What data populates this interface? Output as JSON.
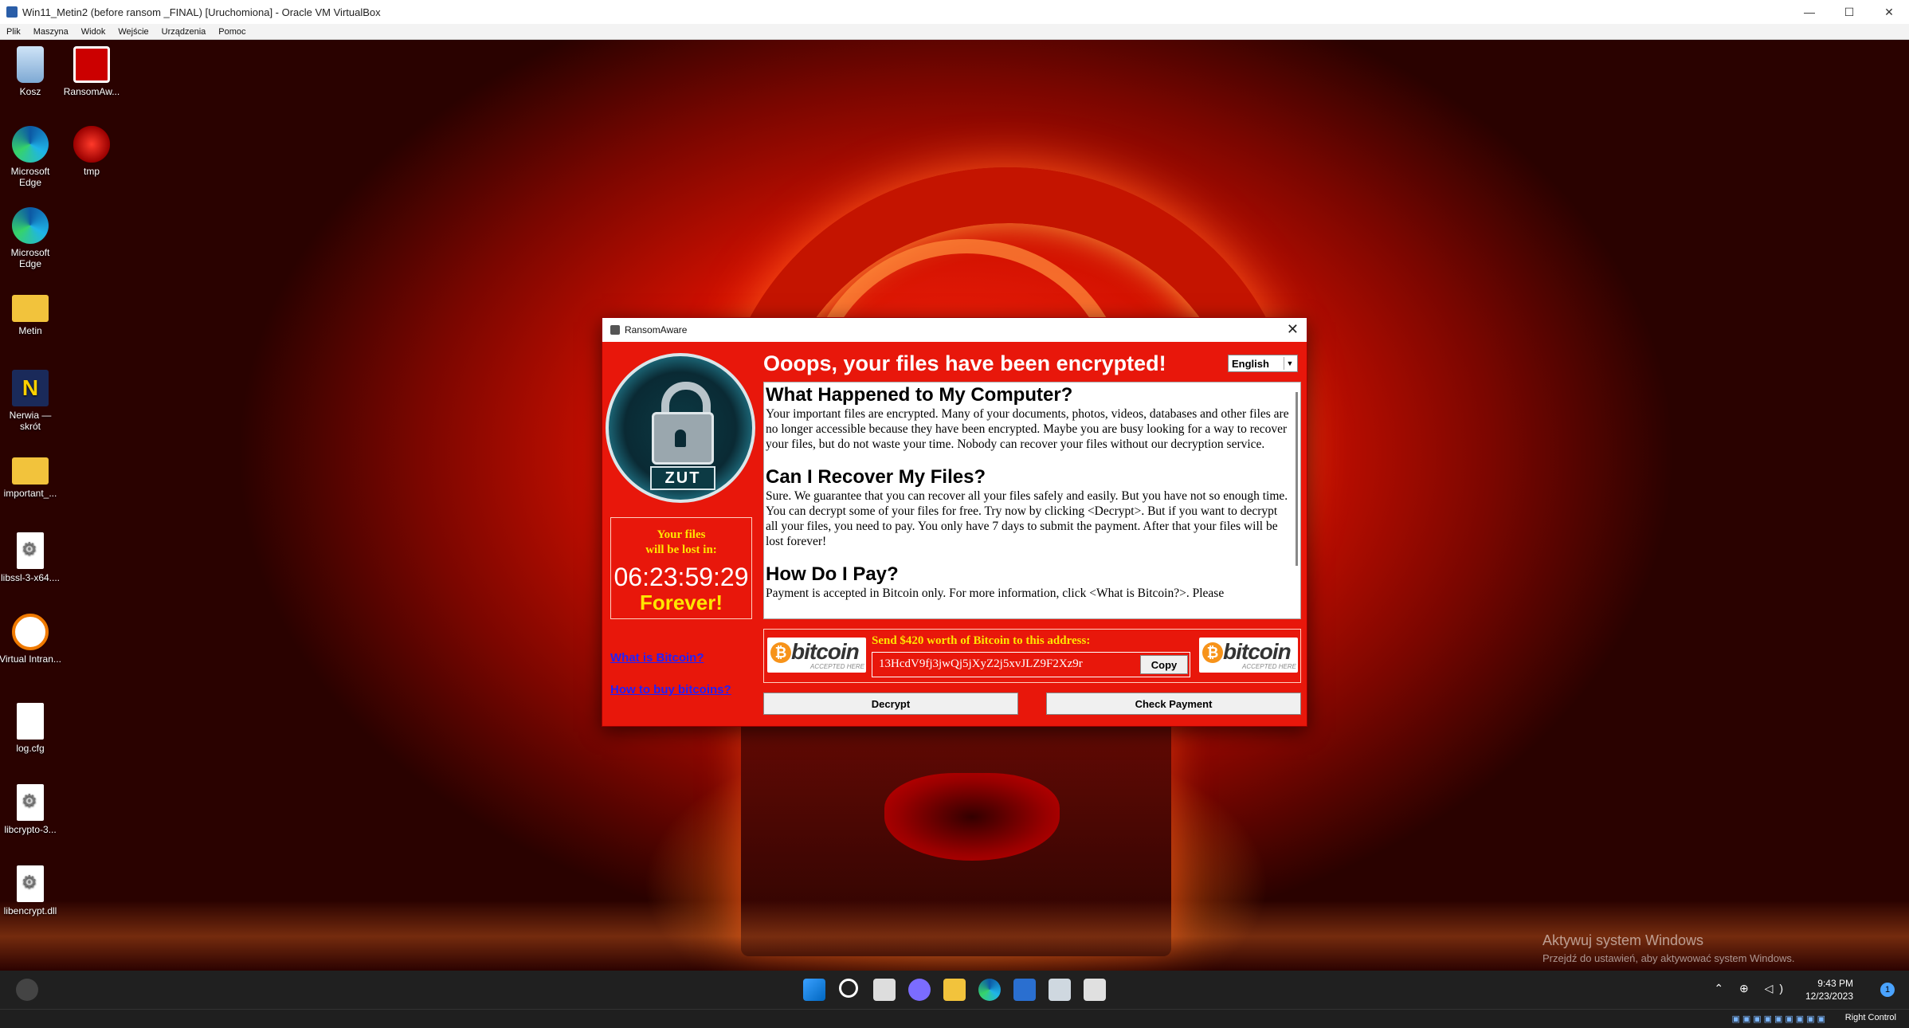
{
  "vbox": {
    "title": "Win11_Metin2 (before ransom _FINAL) [Uruchomiona] - Oracle VM VirtualBox",
    "menu": [
      "Plik",
      "Maszyna",
      "Widok",
      "Wejście",
      "Urządzenia",
      "Pomoc"
    ],
    "host_key": "Right Control"
  },
  "desktop": {
    "icons": [
      {
        "label": "Kosz",
        "icon": "recycle-bin-icon"
      },
      {
        "label": "RansomAw...",
        "icon": "ransomaware-icon"
      },
      {
        "label": "Microsoft Edge",
        "icon": "edge-icon"
      },
      {
        "label": "tmp",
        "icon": "tmp-icon"
      },
      {
        "label": "Microsoft Edge",
        "icon": "edge-icon"
      },
      {
        "label": "Metin",
        "icon": "folder-icon"
      },
      {
        "label": "Nerwia — skrót",
        "icon": "nerwia-icon"
      },
      {
        "label": "important_...",
        "icon": "folder-icon"
      },
      {
        "label": "libssl-3-x64....",
        "icon": "dll-icon"
      },
      {
        "label": "Virtual Intran...",
        "icon": "vpn-icon"
      },
      {
        "label": "log.cfg",
        "icon": "file-icon"
      },
      {
        "label": "libcrypto-3...",
        "icon": "dll-icon"
      },
      {
        "label": "libencrypt.dll",
        "icon": "dll-icon"
      }
    ],
    "watermark_title": "Aktywuj system Windows",
    "watermark_sub": "Przejdź do ustawień, aby aktywować system Windows."
  },
  "ransom": {
    "window_title": "RansomAware",
    "logo_text": "ZUT",
    "headline": "Ooops, your files have been encrypted!",
    "language": "English",
    "timer_label_1": "Your files",
    "timer_label_2": "will be lost in:",
    "timer_value": "06:23:59:29",
    "timer_forever": "Forever!",
    "link_bitcoin": "What is Bitcoin?",
    "link_buy": "How to buy bitcoins?",
    "sections": [
      {
        "heading": "What Happened to My Computer?",
        "body": "Your important files are encrypted. Many of your documents, photos, videos, databases and other files are no longer accessible because they have been encrypted. Maybe you are busy looking for a way to recover your files, but do not waste your time. Nobody can recover your files without our decryption service."
      },
      {
        "heading": "Can I Recover My Files?",
        "body": "Sure. We guarantee that you can recover all your files safely and easily. But you have not so enough time. You can decrypt some of your files for free. Try now by clicking <Decrypt>. But if you want to decrypt all your files, you need to pay. You only have 7 days to submit the payment. After that your files will be lost forever!"
      },
      {
        "heading": "How Do I Pay?",
        "body": "Payment is accepted in Bitcoin only. For more information, click <What is Bitcoin?>. Please"
      }
    ],
    "bitcoin_word": "bitcoin",
    "bitcoin_sub": "ACCEPTED HERE",
    "send_label": "Send $420 worth of Bitcoin to this address:",
    "address": "13HcdV9fj3jwQj5jXyZ2j5xvJLZ9F2Xz9r",
    "copy_label": "Copy",
    "decrypt_label": "Decrypt",
    "check_label": "Check Payment"
  },
  "taskbar": {
    "time": "9:43 PM",
    "date": "12/23/2023",
    "notifications": "1"
  }
}
